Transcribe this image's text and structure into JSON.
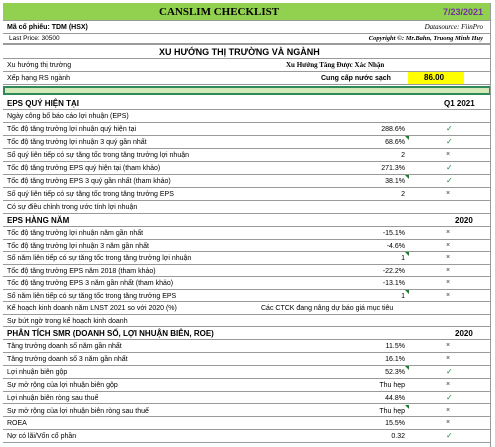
{
  "header": {
    "title": "CANSLIM CHECKLIST",
    "date": "7/23/2021",
    "stock_label": "Mã cổ phiếu: TDM (HSX)",
    "datasource": "Datasource: FiinPro",
    "last_price": "Last Price: 30500",
    "copyright": "Copyright ©: Mr.Bahn, Truong Minh Huy",
    "colors": {
      "header_bg": "#92d050",
      "title_date": "#7030a0",
      "highlight": "#ffff00"
    }
  },
  "market": {
    "section_title": "XU HƯỚNG THỊ TRƯỜNG VÀ NGÀNH",
    "trend_label": "Xu hướng thị trường",
    "trend_value": "Xu Hướng Tăng Được Xác Nhận",
    "rs_label": "Xếp hạng RS ngành",
    "sector": "Cung cấp nước sạch",
    "rs_value": "86.00"
  },
  "eps_quarter": {
    "title": "EPS QUÝ HIỆN TẠI",
    "period": "Q1 2021",
    "rows": [
      {
        "label": "Ngày công bố báo cáo lợi nhuận (EPS)",
        "value": "",
        "mark": ""
      },
      {
        "label": "Tốc độ tăng trưởng lợi nhuận quý hiện tại",
        "value": "288.6%",
        "mark": "check"
      },
      {
        "label": "Tốc độ tăng trưởng lợi nhuận 3 quý gần nhất",
        "value": "68.6%",
        "mark": "check"
      },
      {
        "label": "Số quý liên tiếp có sự tăng tốc trong tăng trưởng lợi nhuận",
        "value": "2",
        "mark": "cross"
      },
      {
        "label": "Tốc độ tăng trưởng EPS quý hiện tại (tham khảo)",
        "value": "271.3%",
        "mark": "check"
      },
      {
        "label": "Tốc độ tăng trưởng EPS 3 quý gần nhất (tham khảo)",
        "value": "38.1%",
        "mark": "check"
      },
      {
        "label": "Số quý liên tiếp có sự tăng tốc trong tăng trưởng EPS",
        "value": "2",
        "mark": "cross"
      },
      {
        "label": "Có sự điều chỉnh trong ước tính lợi nhuận",
        "value": "",
        "mark": ""
      }
    ]
  },
  "eps_year": {
    "title": "EPS HÀNG NĂM",
    "period": "2020",
    "rows": [
      {
        "label": "Tốc độ tăng trưởng lợi nhuận năm gần nhất",
        "value": "-15.1%",
        "mark": "cross"
      },
      {
        "label": "Tốc độ tăng trưởng lợi nhuận 3 năm gần nhất",
        "value": "-4.6%",
        "mark": "cross"
      },
      {
        "label": "Số năm liên tiếp có sự tăng tốc trong tăng trưởng lợi nhuận",
        "value": "1",
        "mark": "cross"
      },
      {
        "label": "Tốc độ tăng trưởng EPS năm 2018 (tham khảo)",
        "value": "-22.2%",
        "mark": "cross"
      },
      {
        "label": "Tốc độ tăng trưởng EPS 3 năm gần nhất (tham khảo)",
        "value": "-13.1%",
        "mark": "cross"
      },
      {
        "label": "Số năm liên tiếp có sự tăng tốc trong tăng trưởng EPS",
        "value": "1",
        "mark": "cross"
      },
      {
        "label": "Kế hoạch kinh doanh năm LNST 2021 so với 2020 (%)",
        "value": "Các CTCK đang nâng dự báo giá mục tiêu",
        "mark": ""
      },
      {
        "label": "Sự bứt ngờ trong kế hoạch kinh doanh",
        "value": "",
        "mark": ""
      }
    ]
  },
  "smr": {
    "title": "PHÂN TÍCH SMR (DOANH SỐ, LỢI NHUẬN BIÊN, ROE)",
    "period": "2020",
    "rows": [
      {
        "label": "Tăng trưởng doanh số năm gần nhất",
        "value": "11.5%",
        "mark": "cross"
      },
      {
        "label": "Tăng trưởng doanh số 3 năm gần nhất",
        "value": "16.1%",
        "mark": "cross"
      },
      {
        "label": "Lợi nhuận biên gộp",
        "value": "52.3%",
        "mark": "check"
      },
      {
        "label": "Sự mở rộng của lợi nhuận biên gộp",
        "value": "Thu hẹp",
        "mark": "cross"
      },
      {
        "label": "Lợi nhuận biên ròng sau thuế",
        "value": "44.8%",
        "mark": "check"
      },
      {
        "label": "Sự mở rộng của lợi nhuận biên ròng sau thuế",
        "value": "Thu hẹp",
        "mark": "cross"
      },
      {
        "label": "ROEA",
        "value": "15.5%",
        "mark": "cross"
      },
      {
        "label": "Nợ có lãi/Vốn cổ phần",
        "value": "0.32",
        "mark": "check"
      }
    ]
  }
}
